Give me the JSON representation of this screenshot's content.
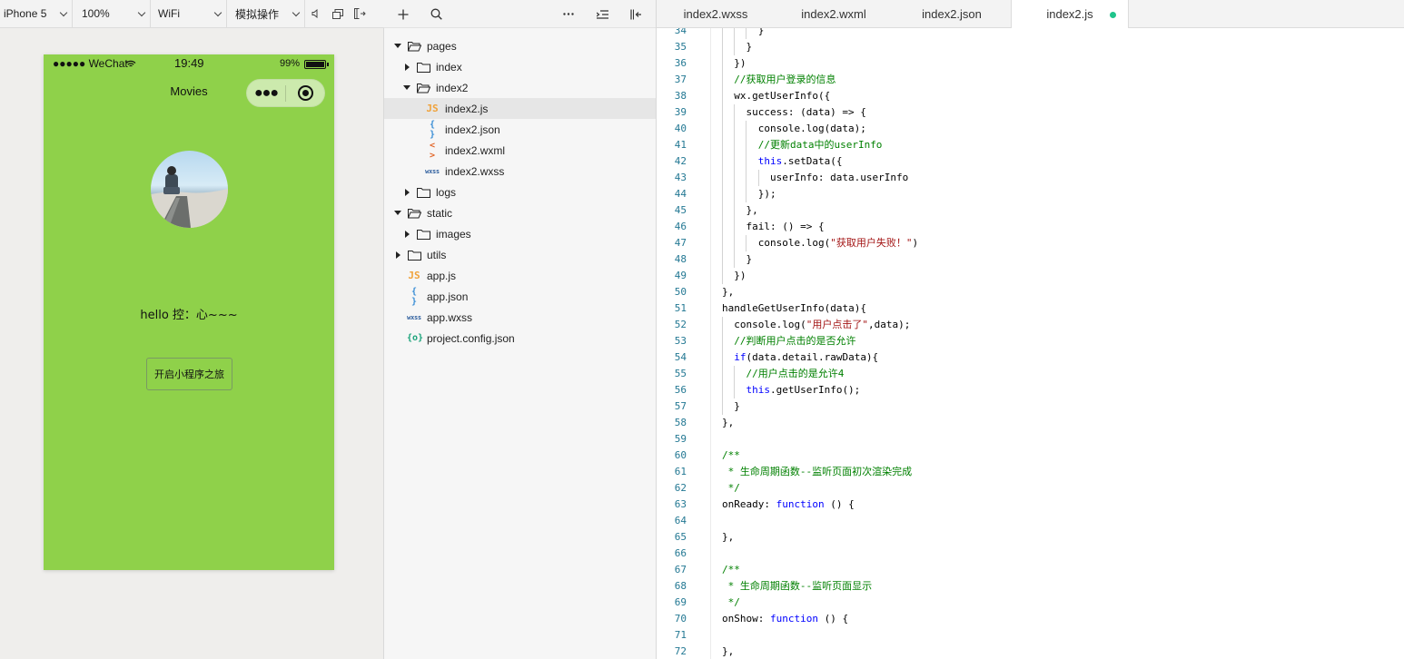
{
  "simulator": {
    "device": "iPhone 5",
    "zoom": "100%",
    "network": "WiFi",
    "operation": "模拟操作",
    "phone": {
      "carrier": "●●●●● WeChat",
      "time": "19:49",
      "battery_text": "99%",
      "battery_level": 0.99,
      "nav_title": "Movies",
      "capsule_more": "●●●",
      "greeting": "hello 控：心~~~",
      "button_label": "开启小程序之旅",
      "background_color": "#8fd14a"
    }
  },
  "file_tree": {
    "nodes": [
      {
        "label": "pages",
        "kind": "folder",
        "expanded": true,
        "depth": 0
      },
      {
        "label": "index",
        "kind": "folder",
        "expanded": false,
        "depth": 1
      },
      {
        "label": "index2",
        "kind": "folder",
        "expanded": true,
        "depth": 1
      },
      {
        "label": "index2.js",
        "kind": "js",
        "icon": "JS",
        "depth": 2,
        "selected": true
      },
      {
        "label": "index2.json",
        "kind": "json",
        "icon": "{ }",
        "depth": 2
      },
      {
        "label": "index2.wxml",
        "kind": "wxml",
        "icon": "< >",
        "depth": 2
      },
      {
        "label": "index2.wxss",
        "kind": "wxss",
        "icon": "wxss",
        "depth": 2
      },
      {
        "label": "logs",
        "kind": "folder",
        "expanded": false,
        "depth": 1
      },
      {
        "label": "static",
        "kind": "folder",
        "expanded": true,
        "depth": 0
      },
      {
        "label": "images",
        "kind": "folder",
        "expanded": false,
        "depth": 1
      },
      {
        "label": "utils",
        "kind": "folder",
        "expanded": false,
        "depth": 0
      },
      {
        "label": "app.js",
        "kind": "js",
        "icon": "JS",
        "depth": 1
      },
      {
        "label": "app.json",
        "kind": "json",
        "icon": "{ }",
        "depth": 1
      },
      {
        "label": "app.wxss",
        "kind": "wxss",
        "icon": "wxss",
        "depth": 1
      },
      {
        "label": "project.config.json",
        "kind": "cfg",
        "icon": "{o}",
        "depth": 1
      }
    ]
  },
  "editor": {
    "tabs": [
      {
        "label": "index2.wxss",
        "active": false
      },
      {
        "label": "index2.wxml",
        "active": false
      },
      {
        "label": "index2.json",
        "active": false
      },
      {
        "label": "index2.js",
        "active": true,
        "modified": true
      }
    ],
    "accent_modified": "#1fc48b",
    "lines": [
      {
        "n": "34",
        "indent": 3,
        "parts": [
          [
            "",
            "}"
          ]
        ]
      },
      {
        "n": "35",
        "indent": 2,
        "parts": [
          [
            "",
            "}"
          ]
        ]
      },
      {
        "n": "36",
        "indent": 1,
        "parts": [
          [
            "",
            "})"
          ]
        ]
      },
      {
        "n": "37",
        "indent": 1,
        "parts": [
          [
            "cm",
            "//获取用户登录的信息"
          ]
        ]
      },
      {
        "n": "38",
        "indent": 1,
        "parts": [
          [
            "",
            "wx.getUserInfo({"
          ]
        ]
      },
      {
        "n": "39",
        "indent": 2,
        "parts": [
          [
            "",
            "success: (data) => {"
          ]
        ]
      },
      {
        "n": "40",
        "indent": 3,
        "parts": [
          [
            "",
            "console.log(data);"
          ]
        ]
      },
      {
        "n": "41",
        "indent": 3,
        "parts": [
          [
            "cm",
            "//更新data中的userInfo"
          ]
        ]
      },
      {
        "n": "42",
        "indent": 3,
        "parts": [
          [
            "kw",
            "this"
          ],
          [
            "",
            ".setData({"
          ]
        ]
      },
      {
        "n": "43",
        "indent": 4,
        "parts": [
          [
            "",
            "userInfo: data.userInfo"
          ]
        ]
      },
      {
        "n": "44",
        "indent": 3,
        "parts": [
          [
            "",
            "});"
          ]
        ]
      },
      {
        "n": "45",
        "indent": 2,
        "parts": [
          [
            "",
            "},"
          ]
        ]
      },
      {
        "n": "46",
        "indent": 2,
        "parts": [
          [
            "",
            "fail: () => {"
          ]
        ]
      },
      {
        "n": "47",
        "indent": 3,
        "parts": [
          [
            "",
            "console.log("
          ],
          [
            "st",
            "\"获取用户失败！\""
          ],
          [
            "",
            ")"
          ]
        ]
      },
      {
        "n": "48",
        "indent": 2,
        "parts": [
          [
            "",
            "}"
          ]
        ]
      },
      {
        "n": "49",
        "indent": 1,
        "parts": [
          [
            "",
            "})"
          ]
        ]
      },
      {
        "n": "50",
        "indent": 0,
        "parts": [
          [
            "",
            "},"
          ]
        ]
      },
      {
        "n": "51",
        "indent": 0,
        "parts": [
          [
            "",
            "handleGetUserInfo(data){"
          ]
        ]
      },
      {
        "n": "52",
        "indent": 1,
        "parts": [
          [
            "",
            "console.log("
          ],
          [
            "st",
            "\"用户点击了\""
          ],
          [
            "",
            ",data);"
          ]
        ]
      },
      {
        "n": "53",
        "indent": 1,
        "parts": [
          [
            "cm",
            "//判断用户点击的是否允许"
          ]
        ]
      },
      {
        "n": "54",
        "indent": 1,
        "parts": [
          [
            "kw",
            "if"
          ],
          [
            "",
            "(data.detail.rawData){"
          ]
        ]
      },
      {
        "n": "55",
        "indent": 2,
        "parts": [
          [
            "cm",
            "//用户点击的是允许4"
          ]
        ]
      },
      {
        "n": "56",
        "indent": 2,
        "parts": [
          [
            "kw",
            "this"
          ],
          [
            "",
            ".getUserInfo();"
          ]
        ]
      },
      {
        "n": "57",
        "indent": 1,
        "parts": [
          [
            "",
            "}"
          ]
        ]
      },
      {
        "n": "58",
        "indent": 0,
        "parts": [
          [
            "",
            "},"
          ]
        ]
      },
      {
        "n": "59",
        "indent": 0,
        "parts": [
          [
            "",
            ""
          ]
        ]
      },
      {
        "n": "60",
        "indent": 0,
        "parts": [
          [
            "cm",
            "/**"
          ]
        ]
      },
      {
        "n": "61",
        "indent": 0,
        "parts": [
          [
            "cm",
            " * 生命周期函数--监听页面初次渲染完成"
          ]
        ]
      },
      {
        "n": "62",
        "indent": 0,
        "parts": [
          [
            "cm",
            " */"
          ]
        ]
      },
      {
        "n": "63",
        "indent": 0,
        "parts": [
          [
            "",
            "onReady: "
          ],
          [
            "kw",
            "function"
          ],
          [
            "",
            " () {"
          ]
        ]
      },
      {
        "n": "64",
        "indent": 0,
        "parts": [
          [
            "",
            ""
          ]
        ]
      },
      {
        "n": "65",
        "indent": 0,
        "parts": [
          [
            "",
            "},"
          ]
        ]
      },
      {
        "n": "66",
        "indent": 0,
        "parts": [
          [
            "",
            ""
          ]
        ]
      },
      {
        "n": "67",
        "indent": 0,
        "parts": [
          [
            "cm",
            "/**"
          ]
        ]
      },
      {
        "n": "68",
        "indent": 0,
        "parts": [
          [
            "cm",
            " * 生命周期函数--监听页面显示"
          ]
        ]
      },
      {
        "n": "69",
        "indent": 0,
        "parts": [
          [
            "cm",
            " */"
          ]
        ]
      },
      {
        "n": "70",
        "indent": 0,
        "parts": [
          [
            "",
            "onShow: "
          ],
          [
            "kw",
            "function"
          ],
          [
            "",
            " () {"
          ]
        ]
      },
      {
        "n": "71",
        "indent": 0,
        "parts": [
          [
            "",
            ""
          ]
        ]
      },
      {
        "n": "72",
        "indent": 0,
        "parts": [
          [
            "",
            "},"
          ]
        ]
      }
    ]
  }
}
